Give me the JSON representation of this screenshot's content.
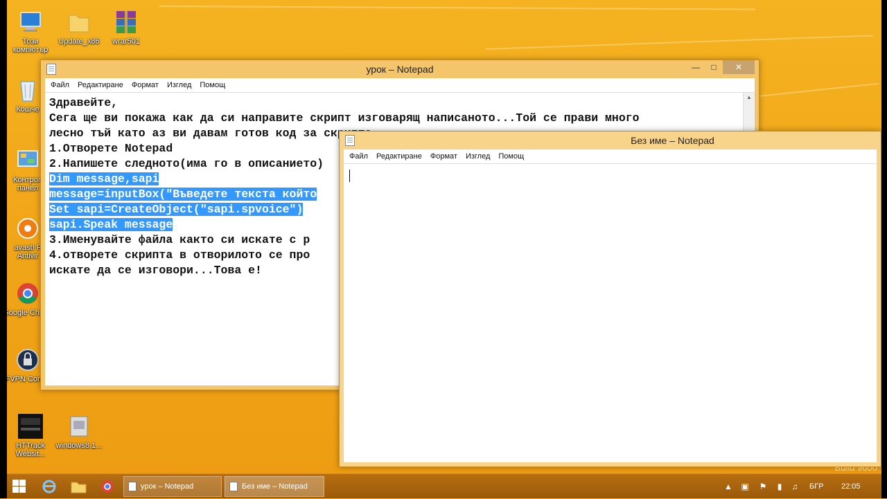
{
  "desktop_icons": [
    {
      "label": "Този компютър",
      "icon": "computer-icon"
    },
    {
      "label": "Update_x86",
      "icon": "folder-icon"
    },
    {
      "label": "wrar501",
      "icon": "winrar-icon"
    },
    {
      "label": "Кошче",
      "icon": "recycle-bin-icon"
    },
    {
      "label": "Контрол панел",
      "icon": "control-panel-icon"
    },
    {
      "label": "avast! F Antivir",
      "icon": "avast-icon"
    },
    {
      "label": "Google Chrom",
      "icon": "chrome-icon"
    },
    {
      "label": "FVPN Conne",
      "icon": "vpn-icon"
    },
    {
      "label": "HTTrack Websit...",
      "icon": "httrack-icon"
    },
    {
      "label": "windows8.1...",
      "icon": "archive-icon"
    }
  ],
  "window_main": {
    "title": "урок – Notepad",
    "menu": [
      "Файл",
      "Редактиране",
      "Формат",
      "Изглед",
      "Помощ"
    ],
    "lines": [
      "Здравейте,",
      "Сега ще ви покажа как да си направите скрипт изговарящ написаното...Той се прави много",
      "лесно тъй като аз ви давам готов код за скрипта.",
      "1.Отворете Notepad",
      "2.Напишете следното(има го в описанието)"
    ],
    "selected_lines": [
      "Dim message,sapi",
      "message=inputBox(\"Въведете текста който",
      "Set sapi=CreateObject(\"sapi.spvoice\")",
      "sapi.Speak message"
    ],
    "lines_after": [
      "3.Именувайте файла както си искате с р",
      "4.отворете скрипта в отворилото се про",
      "искате да се изговори...Това е!"
    ]
  },
  "window_new": {
    "title": "Без име – Notepad",
    "menu": [
      "Файл",
      "Редактиране",
      "Формат",
      "Изглед",
      "Помощ"
    ]
  },
  "taskbar": {
    "tasks": [
      "урок – Notepad",
      "Без име – Notepad"
    ],
    "language": "БГР",
    "time": "22:05"
  },
  "watermark": "Build 9600",
  "colors": {
    "desktop": "#f2a81c",
    "selection": "#3399ff",
    "taskbar": "#a9620c"
  }
}
